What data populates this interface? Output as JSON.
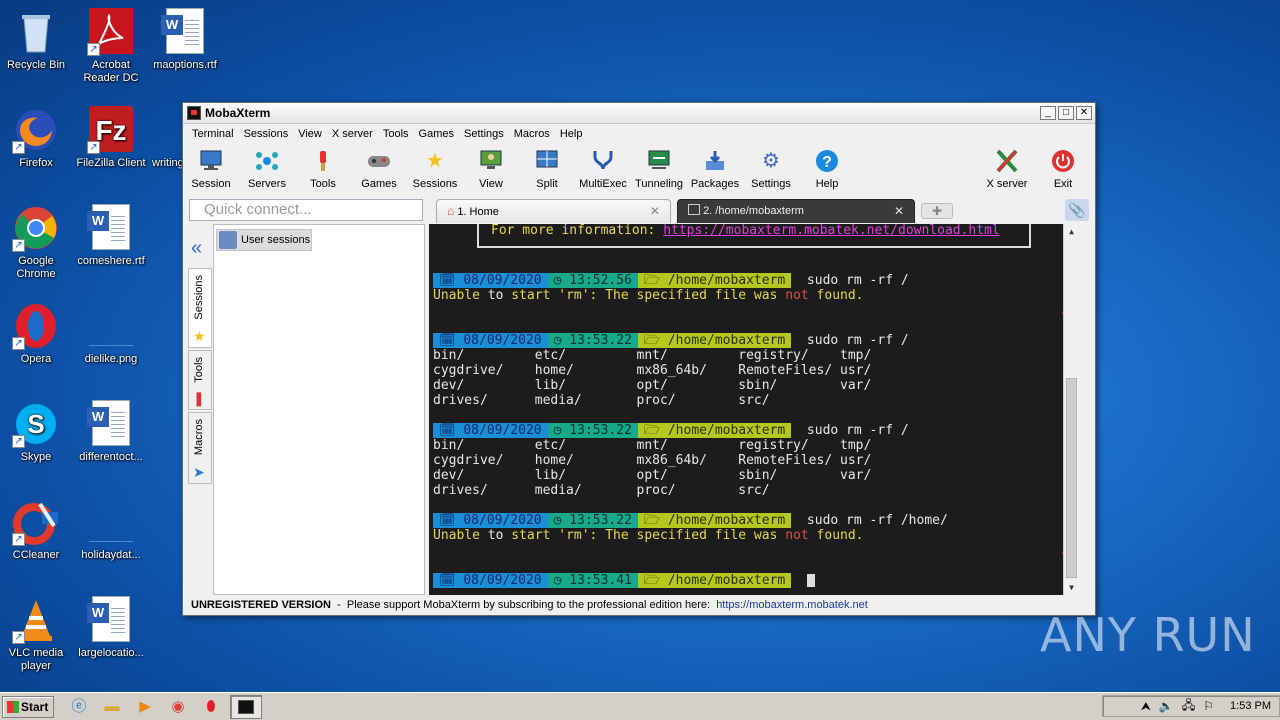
{
  "desktop": {
    "icons": [
      {
        "label": "Recycle Bin"
      },
      {
        "label": "Acrobat Reader DC"
      },
      {
        "label": "maoptions.rtf"
      },
      {
        "label": "Firefox"
      },
      {
        "label": "FileZilla Client"
      },
      {
        "label": "writing"
      },
      {
        "label": "Google Chrome"
      },
      {
        "label": "comeshere.rtf"
      },
      {
        "label": "Opera"
      },
      {
        "label": "dielike.png"
      },
      {
        "label": "Skype"
      },
      {
        "label": "differentoct..."
      },
      {
        "label": "CCleaner"
      },
      {
        "label": "holidaydat..."
      },
      {
        "label": "VLC media player"
      },
      {
        "label": "largelocatio..."
      }
    ]
  },
  "window": {
    "title": "MobaXterm",
    "menu": [
      "Terminal",
      "Sessions",
      "View",
      "X server",
      "Tools",
      "Games",
      "Settings",
      "Macros",
      "Help"
    ],
    "toolbar": [
      "Session",
      "Servers",
      "Tools",
      "Games",
      "Sessions",
      "View",
      "Split",
      "MultiExec",
      "Tunneling",
      "Packages",
      "Settings",
      "Help",
      "X server",
      "Exit"
    ],
    "quick_connect_placeholder": "Quick connect...",
    "tabs": [
      {
        "label": "1. Home"
      },
      {
        "label": "2. /home/mobaxterm"
      }
    ],
    "side_tabs": [
      "Sessions",
      "Tools",
      "Macros"
    ],
    "user_sessions": "User sessions",
    "status": {
      "unregistered": "UNREGISTERED VERSION",
      "message": "  -  Please support MobaXterm by subscribing to the professional edition here:  ",
      "link": "https://mobaxterm.mobatek.net"
    }
  },
  "terminal": {
    "info_prefix": "For more information: ",
    "info_url": "https://mobaxterm.mobatek.net/download.html",
    "path": "/home/mobaxterm",
    "blocks": [
      {
        "date": "08/09/2020",
        "time": "13:52.56",
        "cmd": "sudo rm -rf /"
      },
      {
        "date": "08/09/2020",
        "time": "13:53.22",
        "cmd": "sudo rm -rf /"
      },
      {
        "date": "08/09/2020",
        "time": "13:53.22",
        "cmd": "sudo rm -rf /"
      },
      {
        "date": "08/09/2020",
        "time": "13:53.22",
        "cmd": "sudo rm -rf /home/"
      },
      {
        "date": "08/09/2020",
        "time": "13:53.41",
        "cmd": ""
      }
    ],
    "error": {
      "a": "Unable",
      "b": " to ",
      "c": "start",
      "d": " 'rm': The specified file was ",
      "e": "not",
      "f": " found."
    },
    "listing": [
      "bin/         etc/         mnt/         registry/    tmp/",
      "cygdrive/    home/        mx86_64b/    RemoteFiles/ usr/",
      "dev/         lib/         opt/         sbin/        var/",
      "drives/      media/       proc/        src/"
    ]
  },
  "taskbar": {
    "start": "Start",
    "clock": "1:53 PM"
  },
  "watermark": "ANY RUN"
}
